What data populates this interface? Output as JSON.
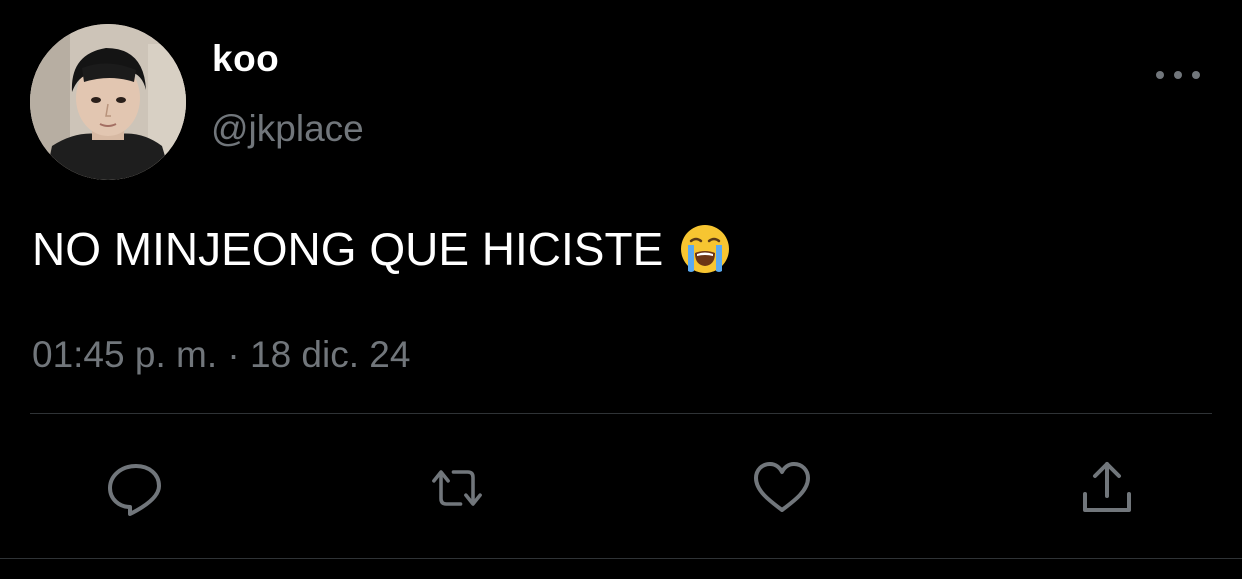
{
  "tweet": {
    "display_name": "koo",
    "handle": "@jkplace",
    "text": "NO MINJEONG QUE HICISTE",
    "emoji": "loudly-crying-face",
    "timestamp": "01:45 p. m. · 18 dic. 24"
  },
  "actions": [
    {
      "name": "reply",
      "icon": "reply-bubble-icon"
    },
    {
      "name": "retweet",
      "icon": "retweet-icon"
    },
    {
      "name": "like",
      "icon": "heart-icon"
    },
    {
      "name": "share",
      "icon": "share-icon"
    }
  ],
  "colors": {
    "background": "#000000",
    "primary_text": "#ffffff",
    "secondary_text": "#71767b",
    "divider": "#2f3336"
  }
}
